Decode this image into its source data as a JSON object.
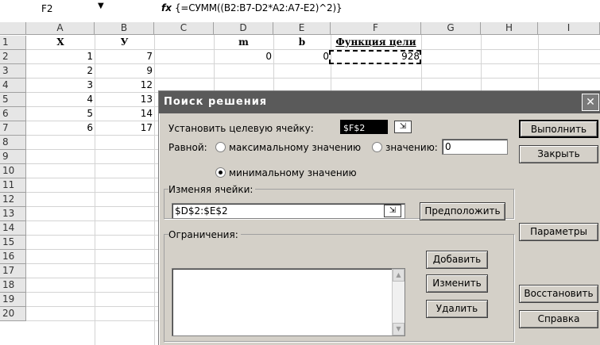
{
  "formula_bar": {
    "name_box": "F2",
    "drop_glyph": "▼",
    "fx_label": "fx",
    "formula": "{=СУММ((B2:B7-D2*A2:A7-E2)^2)}"
  },
  "columns": [
    "A",
    "B",
    "C",
    "D",
    "E",
    "F",
    "G",
    "H",
    "I"
  ],
  "rows": [
    "1",
    "2",
    "3",
    "4",
    "5",
    "6",
    "7",
    "8",
    "9",
    "10",
    "11",
    "12",
    "13",
    "14",
    "15",
    "16",
    "17",
    "18",
    "19",
    "20"
  ],
  "cells": {
    "A1": "X",
    "B1": "У",
    "D1": "m",
    "E1": "b",
    "F1": "Функция цели",
    "A2": "1",
    "B2": "7",
    "D2": "0",
    "E2": "0",
    "F2": "928",
    "A3": "2",
    "B3": "9",
    "A4": "3",
    "B4": "12",
    "A5": "4",
    "B5": "13",
    "A6": "5",
    "B6": "14",
    "A7": "6",
    "B7": "17"
  },
  "dialog": {
    "title": "Поиск решения",
    "close_glyph": "✕",
    "target_label": "Установить целевую ячейку:",
    "target_value": "$F$2",
    "equal_label": "Равной:",
    "radio_max": "максимальному значению",
    "radio_value": "значению:",
    "value_input": "0",
    "radio_min": "минимальному значению",
    "changing_label": "Изменяя ячейки:",
    "changing_value": "$D$2:$E$2",
    "constraints_label": "Ограничения:",
    "buttons": {
      "execute": "Выполнить",
      "close": "Закрыть",
      "guess": "Предположить",
      "options": "Параметры",
      "add": "Добавить",
      "change": "Изменить",
      "reset": "Восстановить",
      "delete": "Удалить",
      "help": "Справка"
    },
    "collapse_glyph": "⇲",
    "scroll_up": "▲",
    "scroll_down": "▼"
  }
}
